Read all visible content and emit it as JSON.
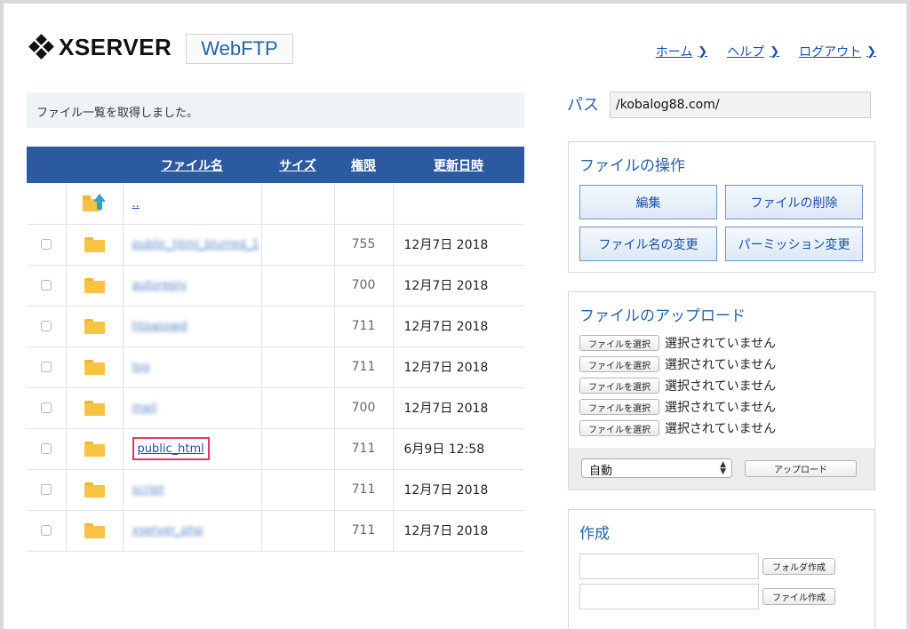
{
  "header": {
    "logo_text": "XSERVER",
    "product": "WebFTP",
    "nav": [
      {
        "label": "ホーム"
      },
      {
        "label": "ヘルプ"
      },
      {
        "label": "ログアウト"
      }
    ]
  },
  "message": "ファイル一覧を取得しました。",
  "table": {
    "headers": {
      "name": "ファイル名",
      "size": "サイズ",
      "perm": "権限",
      "date": "更新日時"
    },
    "parent_link": "..",
    "rows": [
      {
        "name": "public_html_blurred_1",
        "perm": "755",
        "date": "12月7日 2018",
        "blurred": true
      },
      {
        "name": "autoreply",
        "perm": "700",
        "date": "12月7日 2018",
        "blurred": true
      },
      {
        "name": "htpasswd",
        "perm": "711",
        "date": "12月7日 2018",
        "blurred": true
      },
      {
        "name": "log",
        "perm": "711",
        "date": "12月7日 2018",
        "blurred": true
      },
      {
        "name": "mail",
        "perm": "700",
        "date": "12月7日 2018",
        "blurred": true
      },
      {
        "name": "public_html",
        "perm": "711",
        "date": "6月9日 12:58",
        "blurred": false
      },
      {
        "name": "script",
        "perm": "711",
        "date": "12月7日 2018",
        "blurred": true
      },
      {
        "name": "xserver_php",
        "perm": "711",
        "date": "12月7日 2018",
        "blurred": true
      }
    ]
  },
  "path": {
    "label": "パス",
    "value": "/kobalog88.com/"
  },
  "ops": {
    "title": "ファイルの操作",
    "edit": "編集",
    "delete": "ファイルの削除",
    "rename": "ファイル名の変更",
    "permission": "パーミッション変更"
  },
  "upload": {
    "title": "ファイルのアップロード",
    "choose_label": "ファイルを選択",
    "no_file_label": "選択されていません",
    "mode_value": "自動",
    "submit": "アップロード"
  },
  "create": {
    "title": "作成",
    "folder_button": "フォルダ作成",
    "file_button": "ファイル作成"
  }
}
